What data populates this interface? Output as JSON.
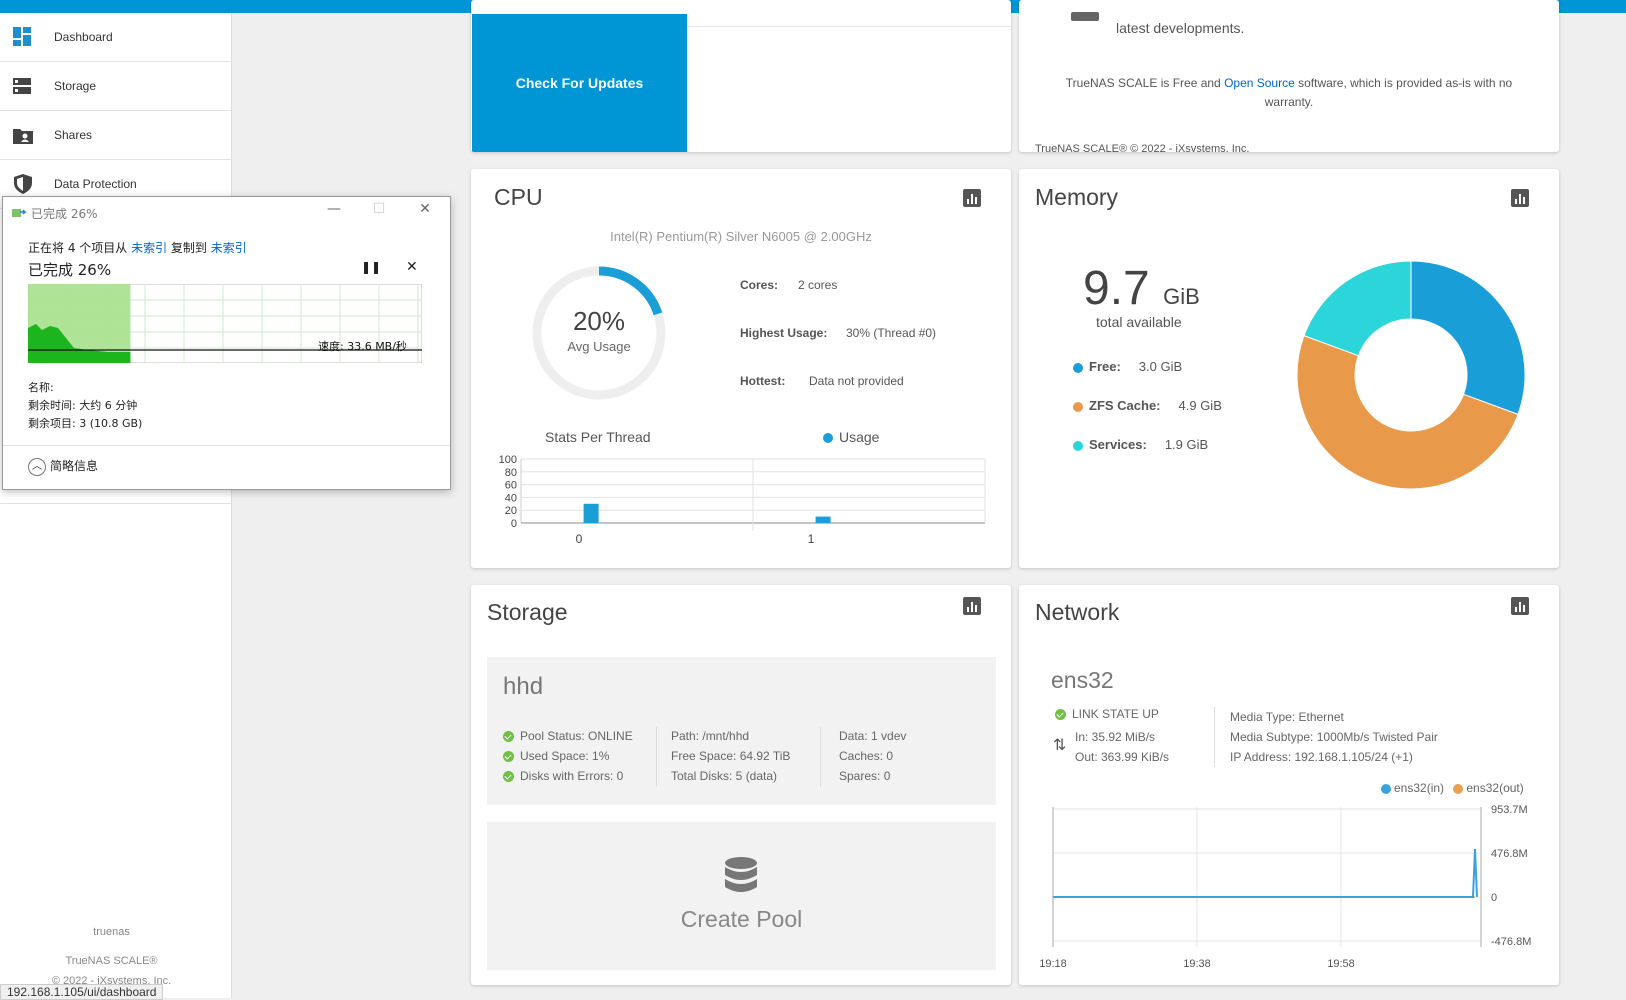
{
  "sidebar": {
    "items": [
      {
        "label": "Dashboard",
        "icon": "dashboard-icon"
      },
      {
        "label": "Storage",
        "icon": "storage-icon"
      },
      {
        "label": "Shares",
        "icon": "shares-icon"
      },
      {
        "label": "Data Protection",
        "icon": "shield-icon"
      }
    ],
    "hostname": "truenas",
    "product": "TrueNAS SCALE®",
    "copyright": "© 2022 - iXsystems, Inc."
  },
  "url_status": "192.168.1.105/ui/dashboard",
  "sysinfo": {
    "update_button": "Check For Updates",
    "news_line": "latest developments.",
    "license_pre": "TrueNAS SCALE is Free and ",
    "license_link": "Open Source",
    "license_post": " software, which is provided as-is with no warranty.",
    "footer": "TrueNAS SCALE® © 2022 - iXsystems, Inc."
  },
  "cpu": {
    "title": "CPU",
    "model": "Intel(R) Pentium(R) Silver N6005 @ 2.00GHz",
    "avg_value": "20%",
    "avg_label": "Avg Usage",
    "avg_fraction": 0.2,
    "cores_label": "Cores:",
    "cores_value": "2 cores",
    "highest_label": "Highest Usage:",
    "highest_value": "30%  (Thread #0)",
    "hottest_label": "Hottest:",
    "hottest_value": "Data not provided",
    "stats_title": "Stats Per Thread",
    "legend_usage": "Usage",
    "accent": "#1a9ed7"
  },
  "chart_data": {
    "type": "bar",
    "categories": [
      "0",
      "1"
    ],
    "series": [
      {
        "name": "Usage",
        "values": [
          30,
          10
        ]
      }
    ],
    "ylim": [
      0,
      100
    ],
    "yticks": [
      0,
      20,
      40,
      60,
      80,
      100
    ],
    "title": "Stats Per Thread"
  },
  "memory": {
    "title": "Memory",
    "total_value": "9.7",
    "total_unit": "GiB",
    "total_label": "total available",
    "legend": [
      {
        "label": "Free:",
        "value": "3.0 GiB",
        "color": "#1a9ed7",
        "gib": 3.0
      },
      {
        "label": "ZFS Cache:",
        "value": "4.9 GiB",
        "color": "#e89a4a",
        "gib": 4.9
      },
      {
        "label": "Services:",
        "value": "1.9 GiB",
        "color": "#2bd5d9",
        "gib": 1.9
      }
    ]
  },
  "storage": {
    "title": "Storage",
    "pool_name": "hhd",
    "col1": [
      "Pool Status:  ONLINE",
      "Used Space:  1%",
      "Disks with Errors:  0"
    ],
    "col2": [
      "Path:  /mnt/hhd",
      "Free Space:  64.92 TiB",
      "Total Disks:  5 (data)"
    ],
    "col3": [
      "Data:  1 vdev",
      "Caches:  0",
      "Spares:  0"
    ],
    "create_pool": "Create Pool"
  },
  "network": {
    "title": "Network",
    "iface": "ens32",
    "link_state": "LINK STATE UP",
    "in_text": "In:  35.92 MiB/s",
    "out_text": "Out:  363.99 KiB/s",
    "media_type": "Media Type:  Ethernet",
    "media_subtype": "Media Subtype:  1000Mb/s Twisted Pair",
    "ip": "IP Address:  192.168.1.105/24 (+1)",
    "legend_in": "ens32(in)",
    "legend_out": "ens32(out)",
    "color_in": "#3aa3dd",
    "color_out": "#e8a054",
    "y_ticks": [
      "953.7M",
      "476.8M",
      "0",
      "-476.8M"
    ],
    "x_ticks": [
      "19:18",
      "19:38",
      "19:58"
    ]
  },
  "dialog": {
    "title": "已完成 26%",
    "line1_pre": "正在将 4 个项目从 ",
    "line1_src": "未索引",
    "line1_mid": " 复制到 ",
    "line1_dst": "未索引",
    "progress_text": "已完成 26%",
    "progress": 0.26,
    "speed": "速度: 33.6 MB/秒",
    "name_label": "名称:",
    "time_left": "剩余时间: 大约 6 分钟",
    "items_left": "剩余项目: 3 (10.8 GB)",
    "details": "简略信息"
  }
}
